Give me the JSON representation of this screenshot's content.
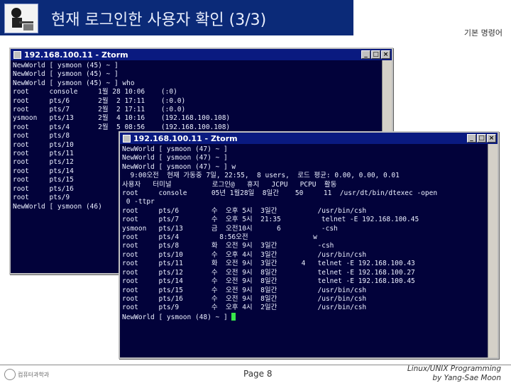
{
  "slide": {
    "title": "현재 로그인한 사용자 확인 (3/3)",
    "subtitle": "기본 명령어",
    "page": "Page 8",
    "credit_line1": "Linux/UNIX Programming",
    "credit_line2": "by Yang-Sae Moon",
    "footer_logo_text": "컴퓨터과학과"
  },
  "terminal_back": {
    "title": "192.168.100.11 - Ztorm",
    "lines": [
      "NewWorld [ ysmoon (45) ~ ]",
      "NewWorld [ ysmoon (45) ~ ]",
      "NewWorld [ ysmoon (45) ~ ] who",
      "root     console     1월 28 10:06    (:0)",
      "root     pts/6       2월  2 17:11    (:0.0)",
      "root     pts/7       2월  2 17:11    (:0.0)",
      "ysmoon   pts/13      2월  4 10:16    (192.168.100.108)",
      "root     pts/4       2월  5 08:56    (192.168.100.108)",
      "root     pts/8",
      "root     pts/10",
      "root     pts/11",
      "root     pts/12",
      "root     pts/14",
      "root     pts/15",
      "root     pts/16",
      "root     pts/9",
      "NewWorld [ ysmoon (46)"
    ]
  },
  "terminal_front": {
    "title": "192.168.100.11 - Ztorm",
    "lines": [
      "NewWorld [ ysmoon (47) ~ ]",
      "NewWorld [ ysmoon (47) ~ ]",
      "NewWorld [ ysmoon (47) ~ ] w",
      "  9:00오전  현재 가동중 7일, 22:55,  8 users,  로드 평균: 0.00, 0.00, 0.01",
      "사용자   터미널          로그인@   휴지   JCPU   PCPU  활동",
      "root     console      05년 1월28일  8일간    50     11  /usr/dt/bin/dtexec -open",
      " 0 -ttpr",
      "root     pts/6        수  오후 5시  3일간          /usr/bin/csh",
      "root     pts/7        수  오후 5시  21:35          telnet -E 192.168.100.45",
      "ysmoon   pts/13       금  오전10시      6          -csh",
      "root     pts/4          8:56오전                w",
      "root     pts/8        화  오전 9시  3일간          -csh",
      "root     pts/10       수  오후 4시  3일간          /usr/bin/csh",
      "root     pts/11       화  오전 9시  3일간      4   telnet -E 192.168.100.43",
      "root     pts/12       수  오전 9시  8일간          telnet -E 192.168.100.27",
      "root     pts/14       수  오전 9시  8일간          telnet -E 192.168.100.45",
      "root     pts/15       수  오전 9시  8일간          /usr/bin/csh",
      "root     pts/16       수  오전 9시  8일간          /usr/bin/csh",
      "root     pts/9        수  오후 4시  2일간          /usr/bin/csh",
      "NewWorld [ ysmoon (48) ~ ] "
    ]
  },
  "window_buttons": {
    "minimize": "_",
    "maximize": "□",
    "close": "×"
  }
}
